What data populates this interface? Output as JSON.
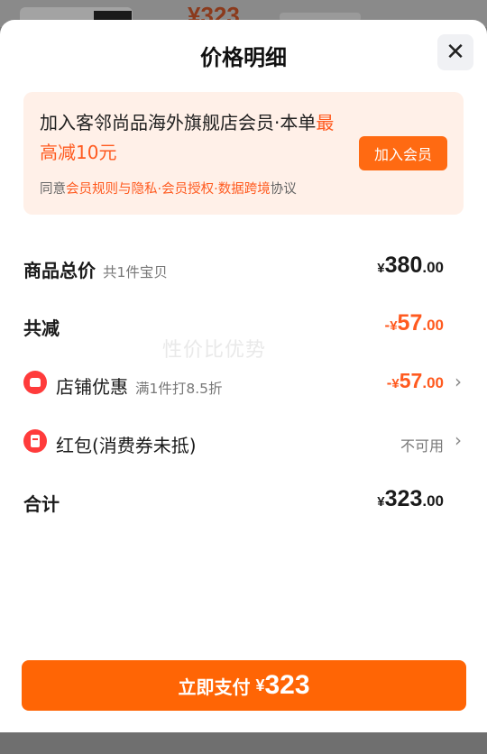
{
  "background": {
    "price_text": "¥323"
  },
  "sheet": {
    "title": "价格明细",
    "close_icon": "close-icon"
  },
  "promo": {
    "text_prefix": "加入客邻尚品海外旗舰店会员·本单",
    "text_highlight": "最高减10元",
    "join_label": "加入会员",
    "agree_prefix": "同意",
    "agree_links": [
      "会员规则与隐私",
      "会员授权",
      "数据跨境"
    ],
    "agree_sep": "·",
    "agree_suffix": "协议"
  },
  "rows": {
    "total": {
      "label": "商品总价",
      "sub": "共1件宝贝",
      "currency": "¥",
      "integer": "380",
      "decimal": ".00"
    },
    "discount": {
      "label": "共减",
      "sign": "-",
      "currency": "¥",
      "integer": "57",
      "decimal": ".00"
    },
    "store_offer": {
      "icon": "store-icon",
      "label": "店铺优惠",
      "sub": "满1件打8.5折",
      "sign": "-",
      "currency": "¥",
      "integer": "57",
      "decimal": ".00"
    },
    "red_packet": {
      "icon": "red-packet-icon",
      "label": "红包(消费券未抵)",
      "value": "不可用"
    },
    "sum": {
      "label": "合计",
      "currency": "¥",
      "integer": "323",
      "decimal": ".00"
    }
  },
  "watermark": "性价比优势",
  "pay": {
    "label": "立即支付",
    "currency": "¥",
    "amount": "323"
  },
  "colors": {
    "accent": "#ff6505",
    "highlight": "#ff5a1f",
    "promo_bg": "#fff0e8"
  }
}
